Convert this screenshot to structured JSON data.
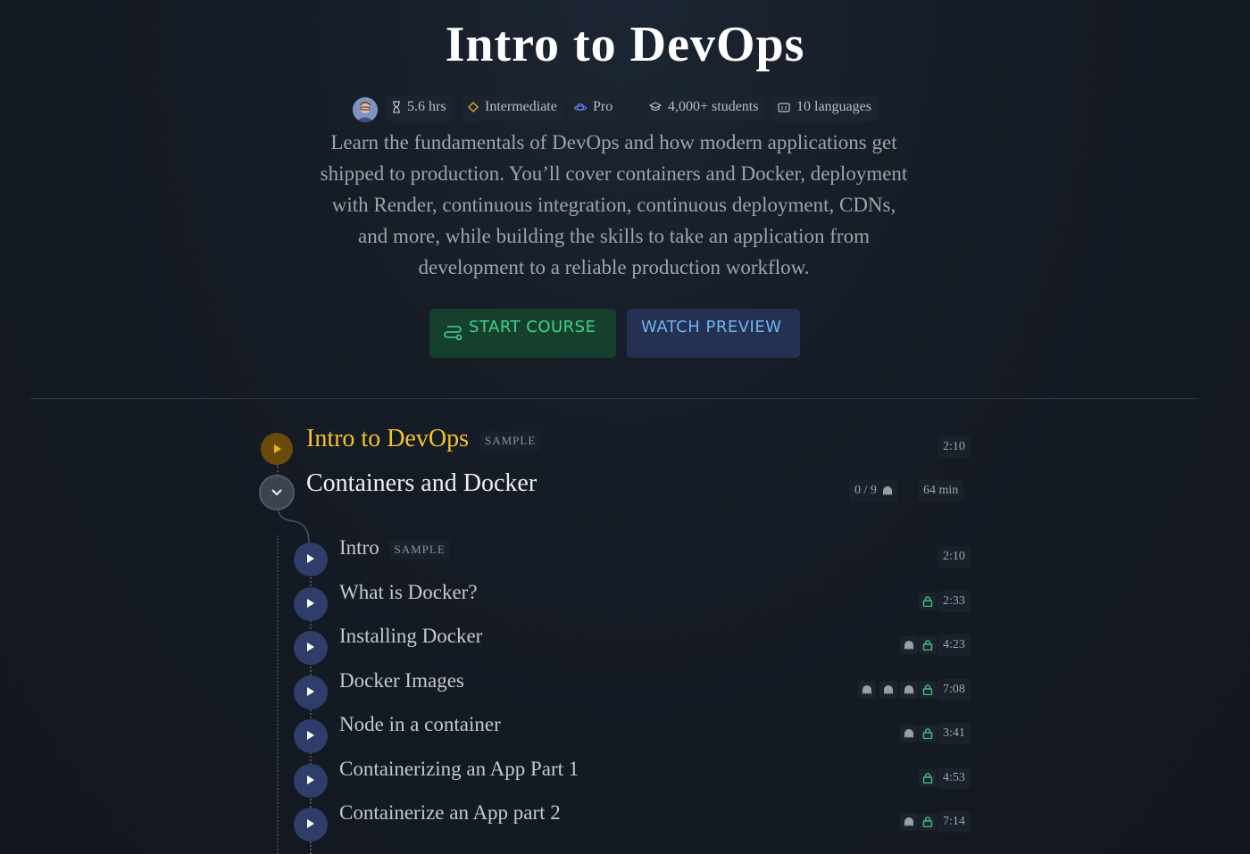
{
  "hero": {
    "title": "Intro to DevOps",
    "meta": {
      "duration": "5.6 hrs",
      "level": "Intermediate",
      "tier": "Pro",
      "students": "4,000+ students",
      "languages": "10 languages"
    },
    "description": "Learn the fundamentals of DevOps and how modern applications get shipped to production. You’ll cover containers and Docker, deployment with Render, continuous integration, continuous deployment, CDNs, and more, while building the skills to take an application from development to a reliable production workflow.",
    "start_button": "START COURSE",
    "preview_button": "WATCH PREVIEW"
  },
  "modules": [
    {
      "title": "Intro to DevOps",
      "badge": "SAMPLE",
      "time": "2:10"
    },
    {
      "title": "Containers and Docker",
      "progress": "0 / 9",
      "duration": "64 min"
    }
  ],
  "lessons": [
    {
      "title": "Intro",
      "badge": "SAMPLE",
      "time": "2:10",
      "locked": false,
      "ghosts": 0
    },
    {
      "title": "What is Docker?",
      "time": "2:33",
      "locked": true,
      "ghosts": 0
    },
    {
      "title": "Installing Docker",
      "time": "4:23",
      "locked": true,
      "ghosts": 1
    },
    {
      "title": "Docker Images",
      "time": "7:08",
      "locked": true,
      "ghosts": 3
    },
    {
      "title": "Node in a container",
      "time": "3:41",
      "locked": true,
      "ghosts": 1
    },
    {
      "title": "Containerizing an App Part 1",
      "time": "4:53",
      "locked": true,
      "ghosts": 0
    },
    {
      "title": "Containerize an App part 2",
      "time": "7:14",
      "locked": true,
      "ghosts": 1
    }
  ],
  "icons": {
    "duration": "hourglass-icon",
    "level": "diamond-icon",
    "tier": "planet-icon",
    "students": "graduation-cap-icon",
    "languages": "captions-icon",
    "start": "route-icon",
    "play": "play-icon",
    "collapse": "chevron-down-icon",
    "lock": "lock-icon",
    "ghost": "ghost-icon"
  },
  "colors": {
    "accent_gold": "#f0c32a",
    "start_green": "#3fd38e",
    "preview_blue": "#6fb4f0",
    "lock_green": "#3fbf7f"
  }
}
